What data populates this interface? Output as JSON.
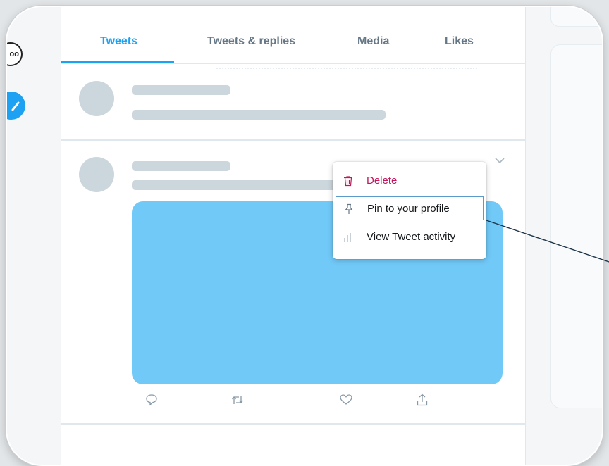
{
  "tabs": [
    {
      "label": "Tweets",
      "active": true
    },
    {
      "label": "Tweets & replies",
      "active": false
    },
    {
      "label": "Media",
      "active": false
    },
    {
      "label": "Likes",
      "active": false
    }
  ],
  "menu": {
    "items": [
      {
        "label": "Delete",
        "icon": "trash-icon",
        "color": "#c2185b"
      },
      {
        "label": "Pin to your profile",
        "icon": "pin-icon",
        "highlighted": true
      },
      {
        "label": "View Tweet activity",
        "icon": "bar-chart-icon"
      }
    ]
  },
  "colors": {
    "accent": "#1da1f2",
    "media": "#71c9f8",
    "placeholder": "#ccd6dd",
    "delete": "#c2185b",
    "highlight_border": "#5b9bc9"
  },
  "rail": {
    "top_icon_text": "oo"
  }
}
